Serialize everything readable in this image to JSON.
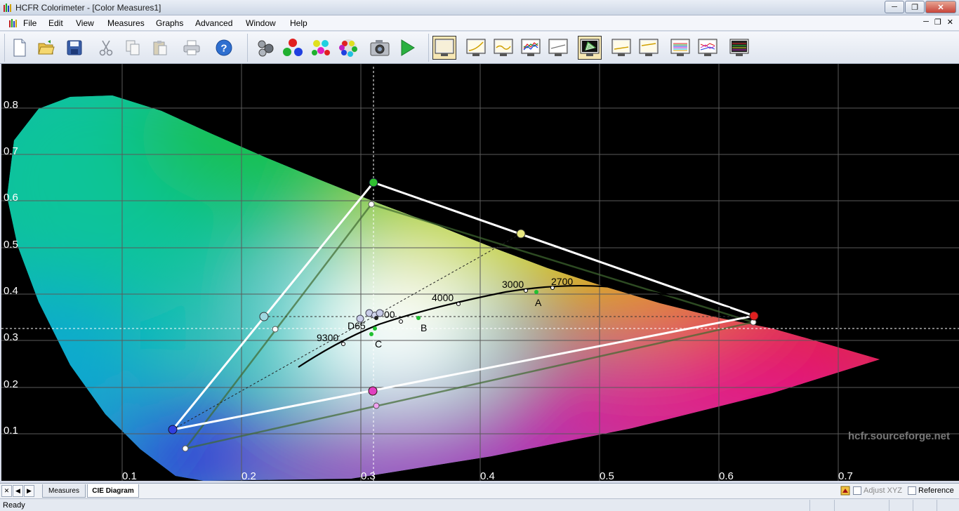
{
  "window": {
    "title": "HCFR Colorimeter - [Color Measures1]"
  },
  "menu": [
    "File",
    "Edit",
    "View",
    "Measures",
    "Graphs",
    "Advanced",
    "Window",
    "Help"
  ],
  "diagram": {
    "x_ticks": [
      "0.1",
      "0.2",
      "0.3",
      "0.4",
      "0.5",
      "0.6",
      "0.7"
    ],
    "y_ticks": [
      "0.8",
      "0.7",
      "0.6",
      "0.5",
      "0.4",
      "0.3",
      "0.2",
      "0.1"
    ],
    "labels": {
      "k2700": "2700",
      "k3000": "3000",
      "k4000": "4000",
      "k9300": "9300",
      "k_partial": "00",
      "d65": "D65",
      "illum_a": "A",
      "illum_b": "B",
      "illum_c": "C"
    },
    "watermark": "hcfr.sourceforge.net"
  },
  "tabs": {
    "measures": "Measures",
    "cie": "CIE Diagram"
  },
  "options": {
    "adjust_xyz": "Adjust XYZ",
    "reference": "Reference"
  },
  "status": {
    "text": "Ready"
  }
}
